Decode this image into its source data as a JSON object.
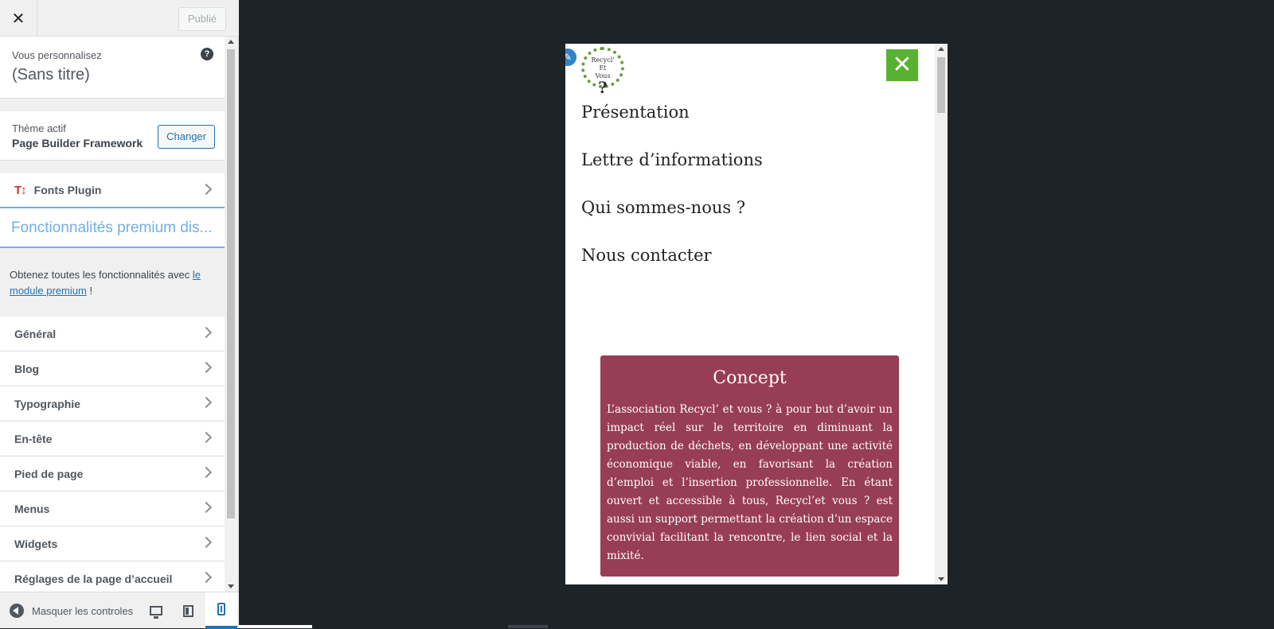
{
  "topbar": {
    "close_symbol": "✕",
    "publish_label": "Publié"
  },
  "info": {
    "subtitle": "Vous personnalisez",
    "title": "(Sans titre)",
    "help_symbol": "?"
  },
  "theme": {
    "subtitle": "Thème actif",
    "name": "Page Builder Framework",
    "change_label": "Changer"
  },
  "fonts_plugin": {
    "icon_text": "T↕",
    "label": "Fonts Plugin"
  },
  "premium": {
    "title": "Fonctionnalités premium dis...",
    "desc_before": "Obtenez toutes les fonctionnalités avec ",
    "link": "le module premium",
    "desc_after": " !"
  },
  "sections": [
    "Général",
    "Blog",
    "Typographie",
    "En-tête",
    "Pied de page",
    "Menus",
    "Widgets",
    "Réglages de la page d’accueil"
  ],
  "footer": {
    "hide_label": "Masquer les controles",
    "active_device": "mobile"
  },
  "preview": {
    "logo_lines": [
      "Recycl'",
      "Et",
      "Vous"
    ],
    "logo_q": "?",
    "close_symbol": "✕",
    "nav": [
      "Présentation",
      "Lettre d’informations",
      "Qui sommes-nous ?",
      "Nous contacter"
    ],
    "concept_title": "Concept",
    "concept_text": "L’association Recycl’ et vous ? à pour but d’avoir un impact réel sur le territoire en diminuant la production de déchets, en développant une activité économique viable, en favorisant la création d’emploi et l’insertion professionnelle. En étant ouvert et accessible à tous, Recycl’et vous ? est aussi un support permettant la création d’un espace convivial facilitant la rencontre, le lien social et la mixité."
  },
  "colors": {
    "accent": "#2271b1",
    "premium_blue": "#72aee6",
    "menu_close_green": "#58b131",
    "concept_bg": "#973d54",
    "backdrop": "#1d2327"
  }
}
